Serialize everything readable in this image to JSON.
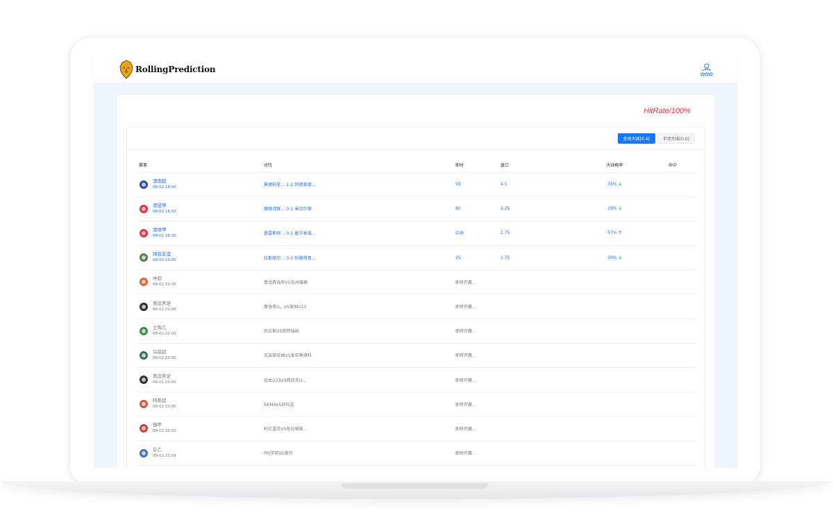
{
  "app": {
    "brand": "RollingPrediction",
    "hit_rate": "HitRate/100%"
  },
  "toggle": {
    "full_match": "全场大球[0.4]",
    "half_match": "半场大球[0.0]"
  },
  "table": {
    "headers": {
      "league": "赛事",
      "match": "对阵",
      "minute": "即时",
      "handicap": "盘口",
      "probability": "大球概率",
      "result": "命中"
    },
    "rows": [
      {
        "league": "澳南超",
        "time": "08-02 18:00",
        "match": "莫德柏里... 1:2 阿德莱德...",
        "minute": "59",
        "handicap": "4.5",
        "rate": "35%",
        "trend": "down",
        "live": true,
        "logo_color": "#1b3b8f"
      },
      {
        "league": "澳昆甲",
        "time": "08-02 18:00",
        "match": "摩顿湾联... 0:1 米切尔顿",
        "minute": "60",
        "handicap": "2.25",
        "rate": "29%",
        "trend": "down",
        "live": true,
        "logo_color": "#e21b2c"
      },
      {
        "league": "澳维甲",
        "time": "08-02 18:30",
        "match": "普雷斯顿... 0:1 墨尔本城...",
        "minute": "中场",
        "handicap": "2.75",
        "rate": "57%",
        "trend": "up",
        "live": true,
        "logo_color": "#e21b2c"
      },
      {
        "league": "球会友谊",
        "time": "08-02 19:00",
        "match": "拉斯帕尔... 0:0 利雅得青...",
        "minute": "25",
        "handicap": "1.75",
        "rate": "30%",
        "trend": "down",
        "live": true,
        "logo_color": "#4c6a2e"
      },
      {
        "league": "中超",
        "time": "08-02 19:35",
        "match": "青岛西海岸VS沧州雄狮",
        "minute": "即将开赛...",
        "handicap": "",
        "rate": "",
        "trend": "",
        "live": false,
        "logo_color": "#e84a24"
      },
      {
        "league": "奥运男足",
        "time": "08-02 21:00",
        "match": "摩洛哥U...VS美国U23",
        "minute": "即将开赛...",
        "handicap": "",
        "rate": "",
        "trend": "",
        "live": false,
        "logo_color": "#1a1a1a"
      },
      {
        "league": "立陶乙",
        "time": "08-02 22:00",
        "match": "托拉斯VS塔特瑞纳",
        "minute": "即将开赛...",
        "handicap": "",
        "rate": "",
        "trend": "",
        "live": false,
        "logo_color": "#2e7d32"
      },
      {
        "league": "乌兹超",
        "time": "08-02 22:45",
        "match": "克兹勒库姆VS本尼奥德科",
        "minute": "即将开赛...",
        "handicap": "",
        "rate": "",
        "trend": "",
        "live": false,
        "logo_color": "#1f5f3a"
      },
      {
        "league": "奥运男足",
        "time": "08-02 23:00",
        "match": "日本U23VS西班牙U...",
        "minute": "即将开赛...",
        "handicap": "",
        "rate": "",
        "trend": "",
        "live": false,
        "logo_color": "#1a1a1a"
      },
      {
        "league": "阿美超",
        "time": "08-02 23:00",
        "match": "BKMAVS舒拉克",
        "minute": "即将开赛...",
        "handicap": "",
        "rate": "",
        "trend": "",
        "live": false,
        "logo_color": "#d9412e"
      },
      {
        "league": "捷甲",
        "time": "08-02 23:30",
        "match": "利贝雷茨VS布拉格斯...",
        "minute": "即将开赛...",
        "handicap": "",
        "rate": "",
        "trend": "",
        "live": false,
        "logo_color": "#c62828"
      },
      {
        "league": "芬乙",
        "time": "08-02 23:59",
        "match": "PPJ学院VS奥芬",
        "minute": "即将开赛...",
        "handicap": "",
        "rate": "",
        "trend": "",
        "live": false,
        "logo_color": "#2f62b0"
      }
    ]
  }
}
